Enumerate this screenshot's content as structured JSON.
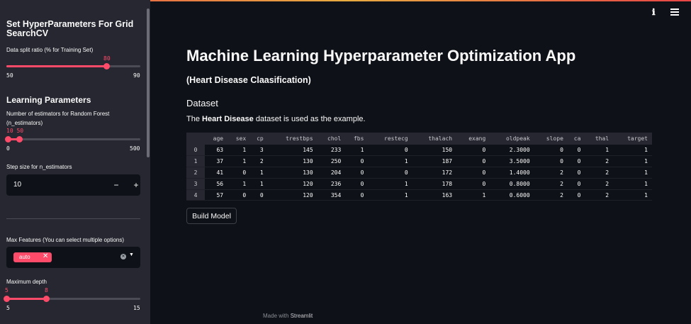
{
  "sidebar": {
    "title": "Set HyperParameters For Grid SearchCV",
    "split": {
      "label": "Data split ratio (% for Training Set)",
      "value": "80",
      "min": "50",
      "max": "90"
    },
    "learning_title": "Learning Parameters",
    "n_est": {
      "label": "Number of estimators for Random Forest",
      "label2": "(n_estimators)",
      "value": "10 50",
      "min": "0",
      "max": "500"
    },
    "step": {
      "label": "Step size for n_estimators",
      "value": "10",
      "minus": "−",
      "plus": "+"
    },
    "max_features": {
      "label": "Max Features (You can select multiple options)",
      "chip": "auto",
      "chip_remove": "✕"
    },
    "depth": {
      "label": "Maximum depth",
      "value_low": "5",
      "value_high": "8",
      "min": "5",
      "max": "15"
    }
  },
  "main": {
    "title": "Machine Learning Hyperparameter Optimization App",
    "subtitle": "(Heart Disease Claasification)",
    "section": "Dataset",
    "para_pre": "The ",
    "para_bold": "Heart Disease",
    "para_post": " dataset is used as the example.",
    "build_button": "Build Model",
    "footer_pre": "Made with ",
    "footer_brand": "Streamlit"
  },
  "table": {
    "columns": [
      "age",
      "sex",
      "cp",
      "trestbps",
      "chol",
      "fbs",
      "restecg",
      "thalach",
      "exang",
      "oldpeak",
      "slope",
      "ca",
      "thal",
      "target"
    ],
    "rows": [
      [
        "0",
        "63",
        "1",
        "3",
        "145",
        "233",
        "1",
        "0",
        "150",
        "0",
        "2.3000",
        "0",
        "0",
        "1",
        "1"
      ],
      [
        "1",
        "37",
        "1",
        "2",
        "130",
        "250",
        "0",
        "1",
        "187",
        "0",
        "3.5000",
        "0",
        "0",
        "2",
        "1"
      ],
      [
        "2",
        "41",
        "0",
        "1",
        "130",
        "204",
        "0",
        "0",
        "172",
        "0",
        "1.4000",
        "2",
        "0",
        "2",
        "1"
      ],
      [
        "3",
        "56",
        "1",
        "1",
        "120",
        "236",
        "0",
        "1",
        "178",
        "0",
        "0.8000",
        "2",
        "0",
        "2",
        "1"
      ],
      [
        "4",
        "57",
        "0",
        "0",
        "120",
        "354",
        "0",
        "1",
        "163",
        "1",
        "0.6000",
        "2",
        "0",
        "2",
        "1"
      ]
    ]
  },
  "colors": {
    "accent": "#ff4b6a",
    "background": "#0e1117",
    "sidebar": "#262730"
  },
  "icons": {
    "menu": "hamburger-menu-icon",
    "help": "info-icon",
    "clear": "clear-icon",
    "caret": "chevron-down-icon"
  }
}
